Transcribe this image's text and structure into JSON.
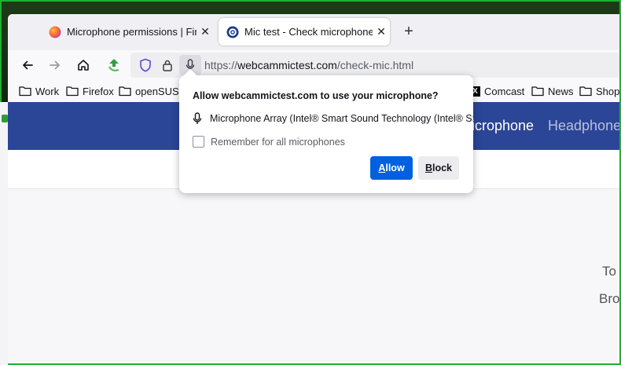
{
  "tabs": [
    {
      "title": "Microphone permissions | Firefo",
      "close": "✕",
      "active": false
    },
    {
      "title": "Mic test - Check microphone or",
      "close": "✕",
      "active": true
    }
  ],
  "new_tab": "+",
  "url": {
    "scheme": "https://",
    "domain": "webcammictest.com",
    "path": "/check-mic.html"
  },
  "bookmarks": [
    "Work",
    "Firefox",
    "openSUSE",
    "Comcast",
    "News",
    "Shop"
  ],
  "comcast_icon": "X",
  "site": {
    "nav_active": "icrophone",
    "nav_next": "Headphone",
    "text_to": "To",
    "text_bro": "Bro"
  },
  "popup": {
    "title": "Allow webcammictest.com to use your microphone?",
    "device": "Microphone Array (Intel® Smart Sound Technology (Intel® SST",
    "remember": "Remember for all microphones",
    "allow_first": "A",
    "allow_rest": "llow",
    "block_first": "B",
    "block_rest": "lock"
  },
  "colors": {
    "accent": "#0061e0",
    "site_header": "#2b4597",
    "frame": "#1fb030"
  }
}
